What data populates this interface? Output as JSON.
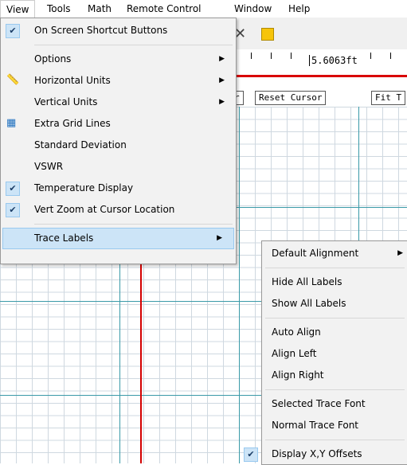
{
  "menubar": {
    "items": [
      "View",
      "Tools",
      "Math",
      "Remote Control",
      "Window",
      "Help"
    ]
  },
  "app": {
    "cursor_readout": "5.6063ft",
    "buttons": [
      "r",
      "Reset Cursor",
      "Fit T"
    ]
  },
  "view_menu": {
    "items": [
      {
        "label": "On Screen Shortcut Buttons",
        "checked": true
      },
      {
        "label": "Options",
        "submenu": true
      },
      {
        "label": "Horizontal Units",
        "submenu": true,
        "icon": "ruler-icon"
      },
      {
        "label": "Vertical Units",
        "submenu": true
      },
      {
        "label": "Extra Grid Lines",
        "icon": "grid-icon"
      },
      {
        "label": "Standard Deviation"
      },
      {
        "label": "VSWR"
      },
      {
        "label": "Temperature Display",
        "checked": true
      },
      {
        "label": "Vert Zoom at Cursor Location",
        "checked": true
      },
      {
        "label": "Trace Labels",
        "submenu": true,
        "highlighted": true
      }
    ]
  },
  "trace_labels_submenu": {
    "items": [
      {
        "label": "Default Alignment",
        "submenu": true
      },
      {
        "label": "Hide All Labels"
      },
      {
        "label": "Show All Labels"
      },
      {
        "label": "Auto Align"
      },
      {
        "label": "Align Left"
      },
      {
        "label": "Align Right"
      },
      {
        "label": "Selected Trace Font"
      },
      {
        "label": "Normal Trace Font"
      },
      {
        "label": "Display X,Y Offsets",
        "checked": true
      }
    ]
  }
}
